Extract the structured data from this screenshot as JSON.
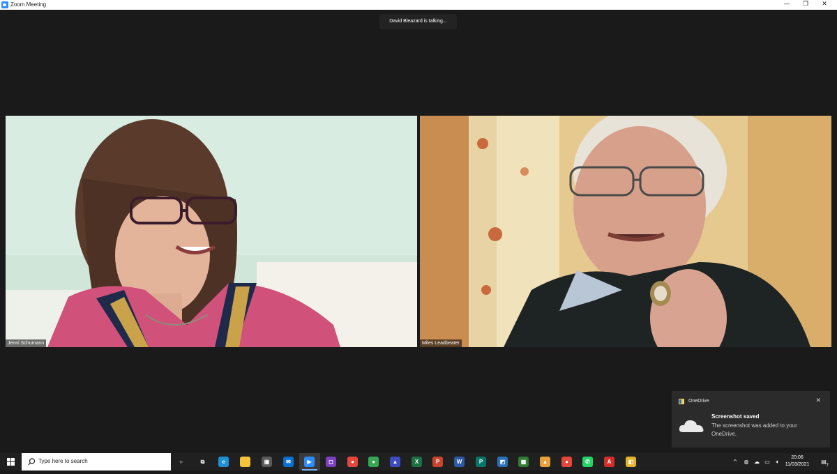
{
  "window": {
    "title": "Zoom Meeting",
    "minimize_glyph": "—",
    "restore_glyph": "❐",
    "close_glyph": "✕"
  },
  "meeting": {
    "active_speaker_text": "David Bleazard is talking...",
    "participants": [
      {
        "name": "Jenni Schumann"
      },
      {
        "name": "Miles Leadbeater"
      }
    ]
  },
  "notification": {
    "app_name": "OneDrive",
    "heading": "Screenshot saved",
    "body": "The screenshot was added to your OneDrive.",
    "close_glyph": "✕"
  },
  "taskbar": {
    "search_placeholder": "Type here to search",
    "apps": [
      {
        "name": "cortana-icon",
        "color": "#202020",
        "glyph": "○"
      },
      {
        "name": "task-view-icon",
        "color": "#202020",
        "glyph": "⧉"
      },
      {
        "name": "edge-icon",
        "color": "#1f8fd6",
        "glyph": "e"
      },
      {
        "name": "file-explorer-icon",
        "color": "#f3c33c",
        "glyph": ""
      },
      {
        "name": "store-icon",
        "color": "#5a5a5a",
        "glyph": "▣"
      },
      {
        "name": "mail-icon",
        "color": "#0a6fd1",
        "glyph": "✉"
      },
      {
        "name": "zoom-icon",
        "color": "#2d8cff",
        "glyph": "▶"
      },
      {
        "name": "app-purple-icon",
        "color": "#7b3fbf",
        "glyph": "◻"
      },
      {
        "name": "chrome-icon",
        "color": "#e3463b",
        "glyph": "●"
      },
      {
        "name": "chrome-canary-icon",
        "color": "#36a852",
        "glyph": "●"
      },
      {
        "name": "vpn-icon",
        "color": "#3b4cc0",
        "glyph": "▲"
      },
      {
        "name": "excel-icon",
        "color": "#1d7044",
        "glyph": "X"
      },
      {
        "name": "powerpoint-icon",
        "color": "#c9442c",
        "glyph": "P"
      },
      {
        "name": "word-icon",
        "color": "#2b5aa6",
        "glyph": "W"
      },
      {
        "name": "publisher-icon",
        "color": "#077568",
        "glyph": "P"
      },
      {
        "name": "app-blue-icon",
        "color": "#2a70b8",
        "glyph": "◩"
      },
      {
        "name": "app-green-icon",
        "color": "#2e7d32",
        "glyph": "▦"
      },
      {
        "name": "photos-icon",
        "color": "#e8a13a",
        "glyph": "▲"
      },
      {
        "name": "chrome-2-icon",
        "color": "#e3463b",
        "glyph": "●"
      },
      {
        "name": "whatsapp-icon",
        "color": "#25d366",
        "glyph": "✆"
      },
      {
        "name": "acrobat-icon",
        "color": "#d1302a",
        "glyph": "A"
      },
      {
        "name": "app-yellow-icon",
        "color": "#e4b32b",
        "glyph": "◧"
      }
    ],
    "tray": {
      "chevron_glyph": "^",
      "time": "20:06",
      "date": "11/03/2021",
      "notification_count": "7"
    }
  }
}
